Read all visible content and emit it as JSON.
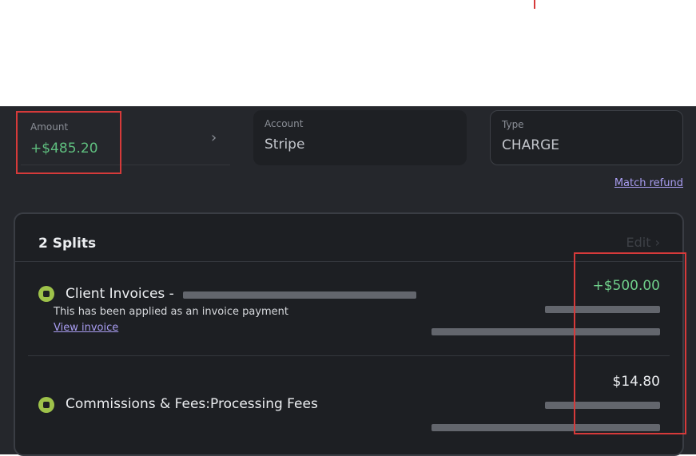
{
  "transaction": {
    "amount_label": "Amount",
    "amount_value": "+$485.20",
    "account_label": "Account",
    "account_value": "Stripe",
    "type_label": "Type",
    "type_value": "CHARGE",
    "match_refund": "Match refund"
  },
  "splits": {
    "title": "2 Splits",
    "edit_label": "Edit ›",
    "items": [
      {
        "name": "Client Invoices -",
        "note": "This has been applied as an invoice payment",
        "link": "View invoice",
        "amount": "+$500.00"
      },
      {
        "name": "Commissions & Fees:Processing Fees",
        "amount": "$14.80"
      }
    ]
  },
  "icons": {
    "amount_chevron": "chevron-right-icon",
    "split_category": "briefcase-icon"
  },
  "colors": {
    "background": "#25272c",
    "card": "#1d1f23",
    "positive": "#6fcf8a",
    "link": "#a89cf0",
    "category_icon": "#9ec24a",
    "highlight": "#d63a3a"
  }
}
